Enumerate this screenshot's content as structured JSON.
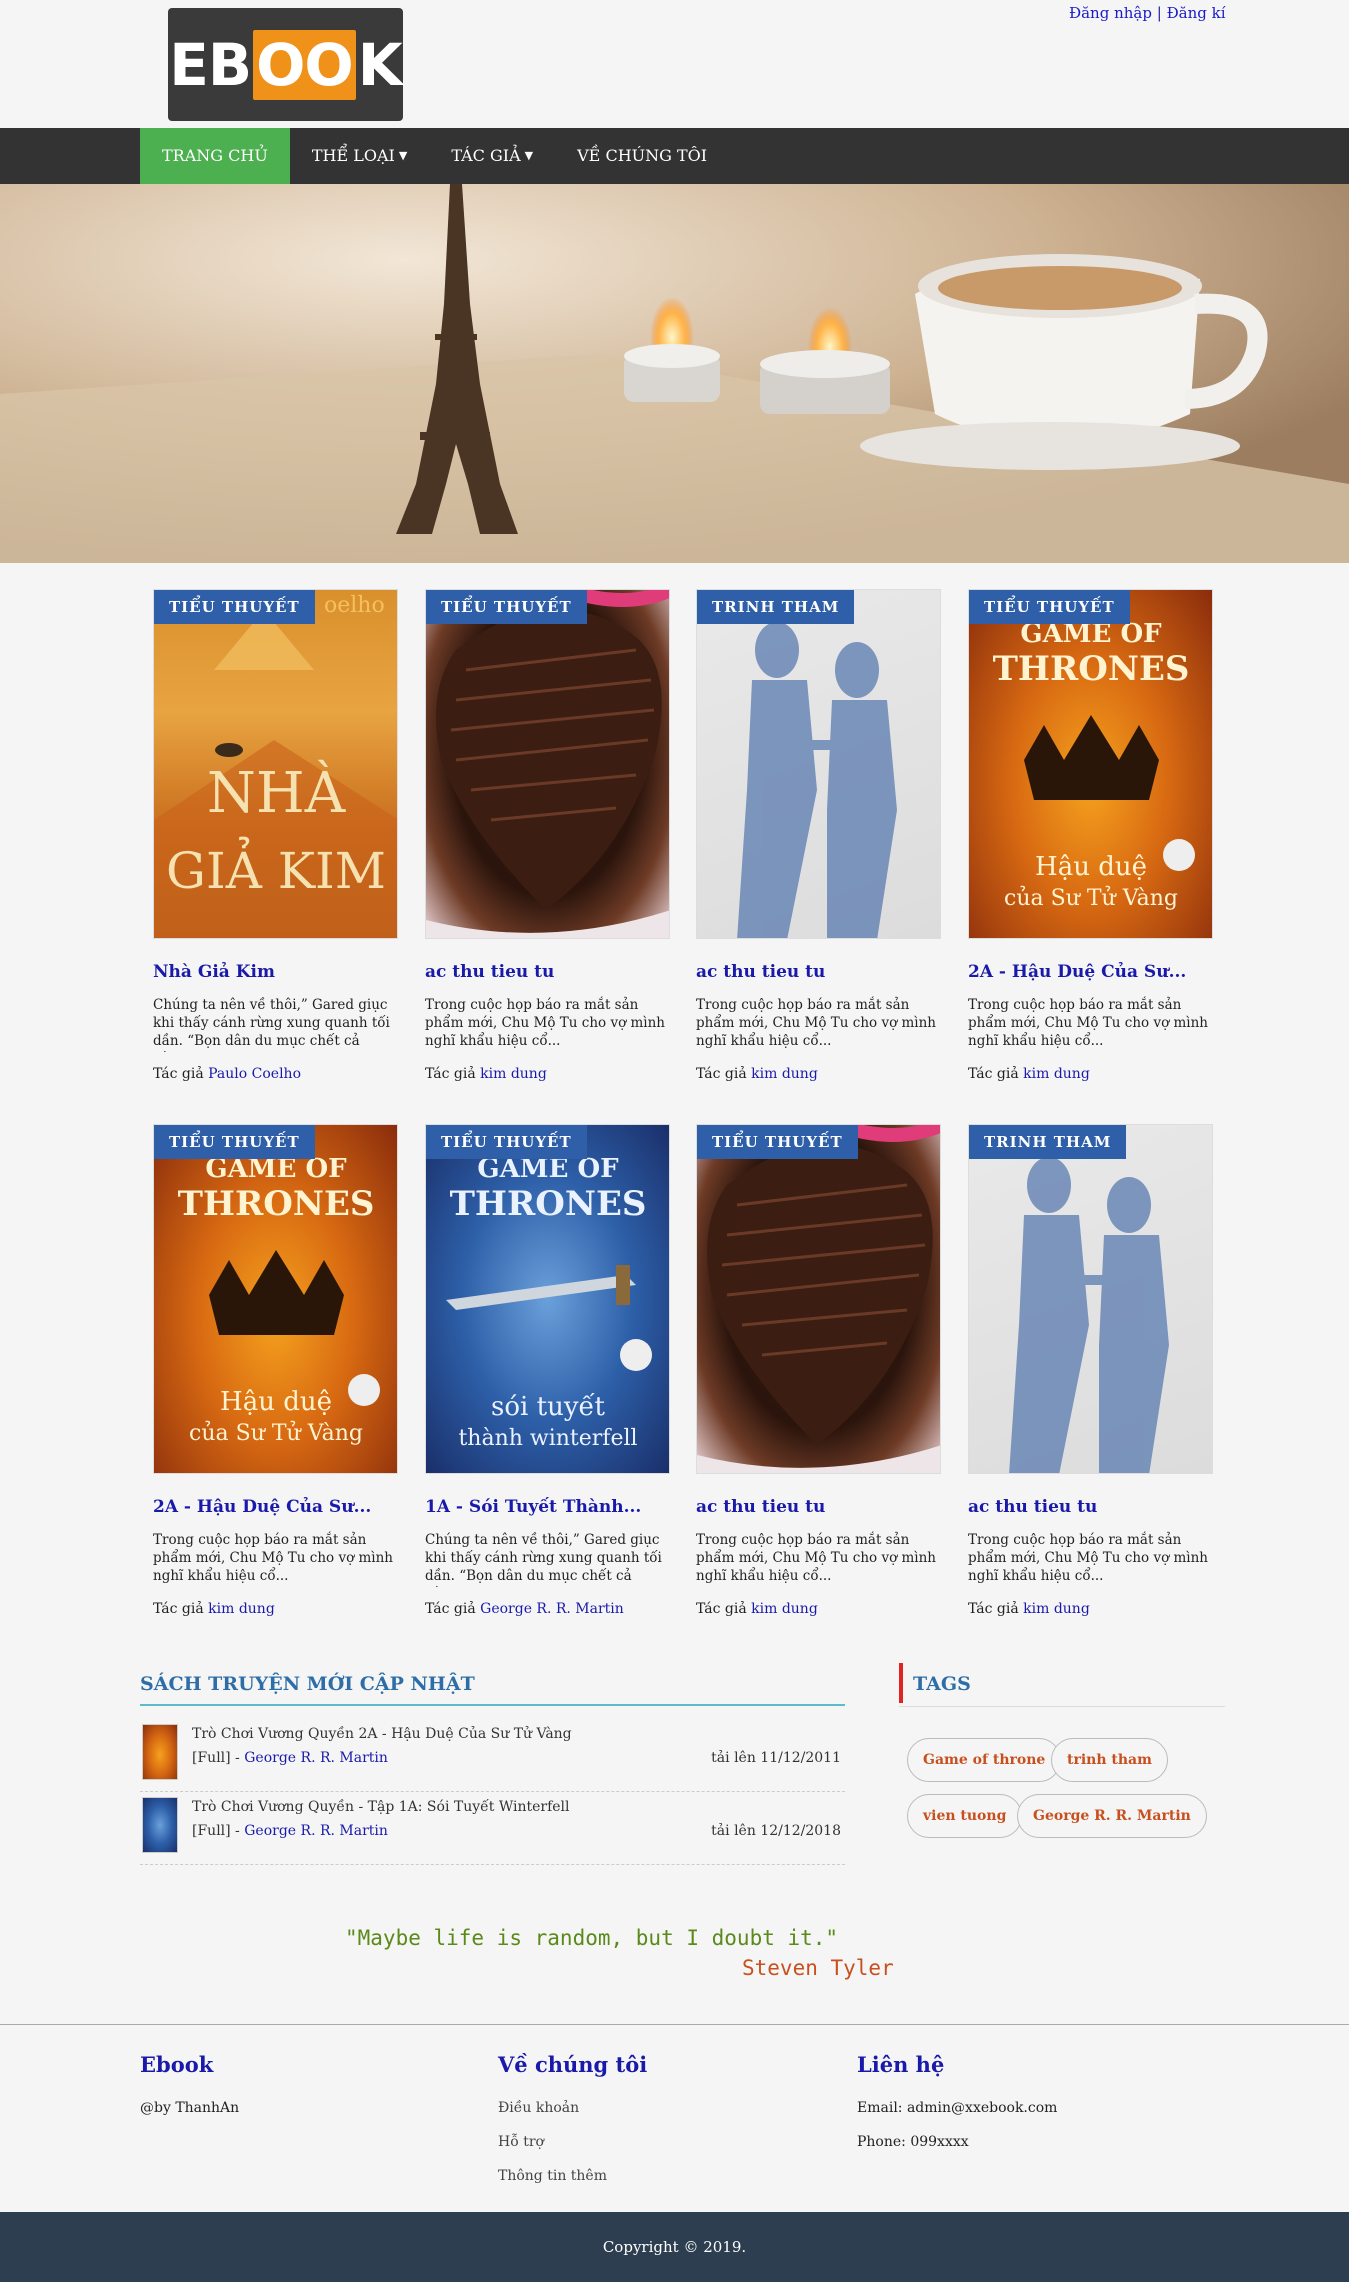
{
  "header": {
    "logo": {
      "left": "EB",
      "mid": "OO",
      "right": "K"
    },
    "login": "Đăng nhập",
    "separator": "|",
    "register": "Đăng kí"
  },
  "nav": [
    {
      "label": "TRANG CHỦ",
      "active": true,
      "dropdown": false
    },
    {
      "label": "THỂ LOẠI",
      "active": false,
      "dropdown": true
    },
    {
      "label": "TÁC GIẢ",
      "active": false,
      "dropdown": true
    },
    {
      "label": "VỀ CHÚNG TÔI",
      "active": false,
      "dropdown": false
    }
  ],
  "books": [
    {
      "badge": "TIỂU THUYẾT",
      "title": "Nhà Giả Kim",
      "desc": "Chúng ta nên về thôi,” Gared giục khi thấy cánh rừng xung quanh tối dần. “Bọn dân du mục chết cả rồi.”...",
      "author_label": "Tác giả",
      "author": "Paulo Coelho",
      "cover_text": "NHÀ GIẢ KIM",
      "cover_top": "oelho"
    },
    {
      "badge": "TIỂU THUYẾT",
      "title": "ac thu tieu tu",
      "desc": "Trong cuộc họp báo ra mắt sản phẩm mới, Chu Mộ Tu cho vợ mình nghĩ khẩu hiệu cổ...",
      "author_label": "Tác giả",
      "author": "kim dung"
    },
    {
      "badge": "TRINH THAM",
      "title": "ac thu tieu tu",
      "desc": "Trong cuộc họp báo ra mắt sản phẩm mới, Chu Mộ Tu cho vợ mình nghĩ khẩu hiệu cổ...",
      "author_label": "Tác giả",
      "author": "kim dung"
    },
    {
      "badge": "TIỂU THUYẾT",
      "title": "2A - Hậu Duệ Của Sư...",
      "desc": "Trong cuộc họp báo ra mắt sản phẩm mới, Chu Mộ Tu cho vợ mình nghĩ khẩu hiệu cổ...",
      "author_label": "Tác giả",
      "author": "kim dung",
      "cover_text": "GAME OF THRONES",
      "cover_sub": "Hậu duệ của Sư Tử Vàng"
    },
    {
      "badge": "TIỂU THUYẾT",
      "title": "2A - Hậu Duệ Của Sư...",
      "desc": "Trong cuộc họp báo ra mắt sản phẩm mới, Chu Mộ Tu cho vợ mình nghĩ khẩu hiệu cổ...",
      "author_label": "Tác giả",
      "author": "kim dung",
      "cover_text": "GAME OF THRONES",
      "cover_sub": "Hậu duệ của Sư Tử Vàng"
    },
    {
      "badge": "TIỂU THUYẾT",
      "title": "1A - Sói Tuyết Thành...",
      "desc": "Chúng ta nên về thôi,” Gared giục khi thấy cánh rừng xung quanh tối dần. “Bọn dân du mục chết cả rồi.”...",
      "author_label": "Tác giả",
      "author": "George R. R. Martin",
      "cover_text": "GAME OF THRONES",
      "cover_sub": "sói tuyết thành winterfell"
    },
    {
      "badge": "TIỂU THUYẾT",
      "title": "ac thu tieu tu",
      "desc": "Trong cuộc họp báo ra mắt sản phẩm mới, Chu Mộ Tu cho vợ mình nghĩ khẩu hiệu cổ...",
      "author_label": "Tác giả",
      "author": "kim dung"
    },
    {
      "badge": "TRINH THAM",
      "title": "ac thu tieu tu",
      "desc": "Trong cuộc họp báo ra mắt sản phẩm mới, Chu Mộ Tu cho vợ mình nghĩ khẩu hiệu cổ...",
      "author_label": "Tác giả",
      "author": "kim dung"
    }
  ],
  "updates": {
    "title": "SÁCH TRUYỆN MỚI CẬP NHẬT",
    "items": [
      {
        "title": "Trò Chơi Vương Quyền 2A - Hậu Duệ Của Sư Tử Vàng",
        "status": "[Full] -",
        "author": "George R. R. Martin",
        "date": "tải lên 11/12/2011"
      },
      {
        "title": "Trò Chơi Vương Quyền - Tập 1A: Sói Tuyết Winterfell",
        "status": "[Full] -",
        "author": "George R. R. Martin",
        "date": "tải lên 12/12/2018"
      }
    ]
  },
  "tags": {
    "title": "TAGS",
    "items": [
      "Game of throne",
      "trinh tham",
      "vien tuong",
      "George R. R. Martin"
    ]
  },
  "quote": {
    "text": "\"Maybe life is random, but I doubt it.\"",
    "author": "Steven Tyler"
  },
  "footer": {
    "col1": {
      "title": "Ebook",
      "text": "@by ThanhAn"
    },
    "col2": {
      "title": "Về chúng tôi",
      "links": [
        "Điều khoản",
        "Hỗ trợ",
        "Thông tin thêm"
      ]
    },
    "col3": {
      "title": "Liên hệ",
      "email": "Email: admin@xxebook.com",
      "phone": "Phone: 099xxxx"
    },
    "copyright": "Copyright © 2019."
  },
  "colors": {
    "nav_bg": "#333333",
    "nav_active": "#4caf50",
    "badge": "#2e5fa8",
    "link": "#1a1aaa",
    "tag_text": "#c8501e",
    "footer_bg": "#2c3e50"
  }
}
